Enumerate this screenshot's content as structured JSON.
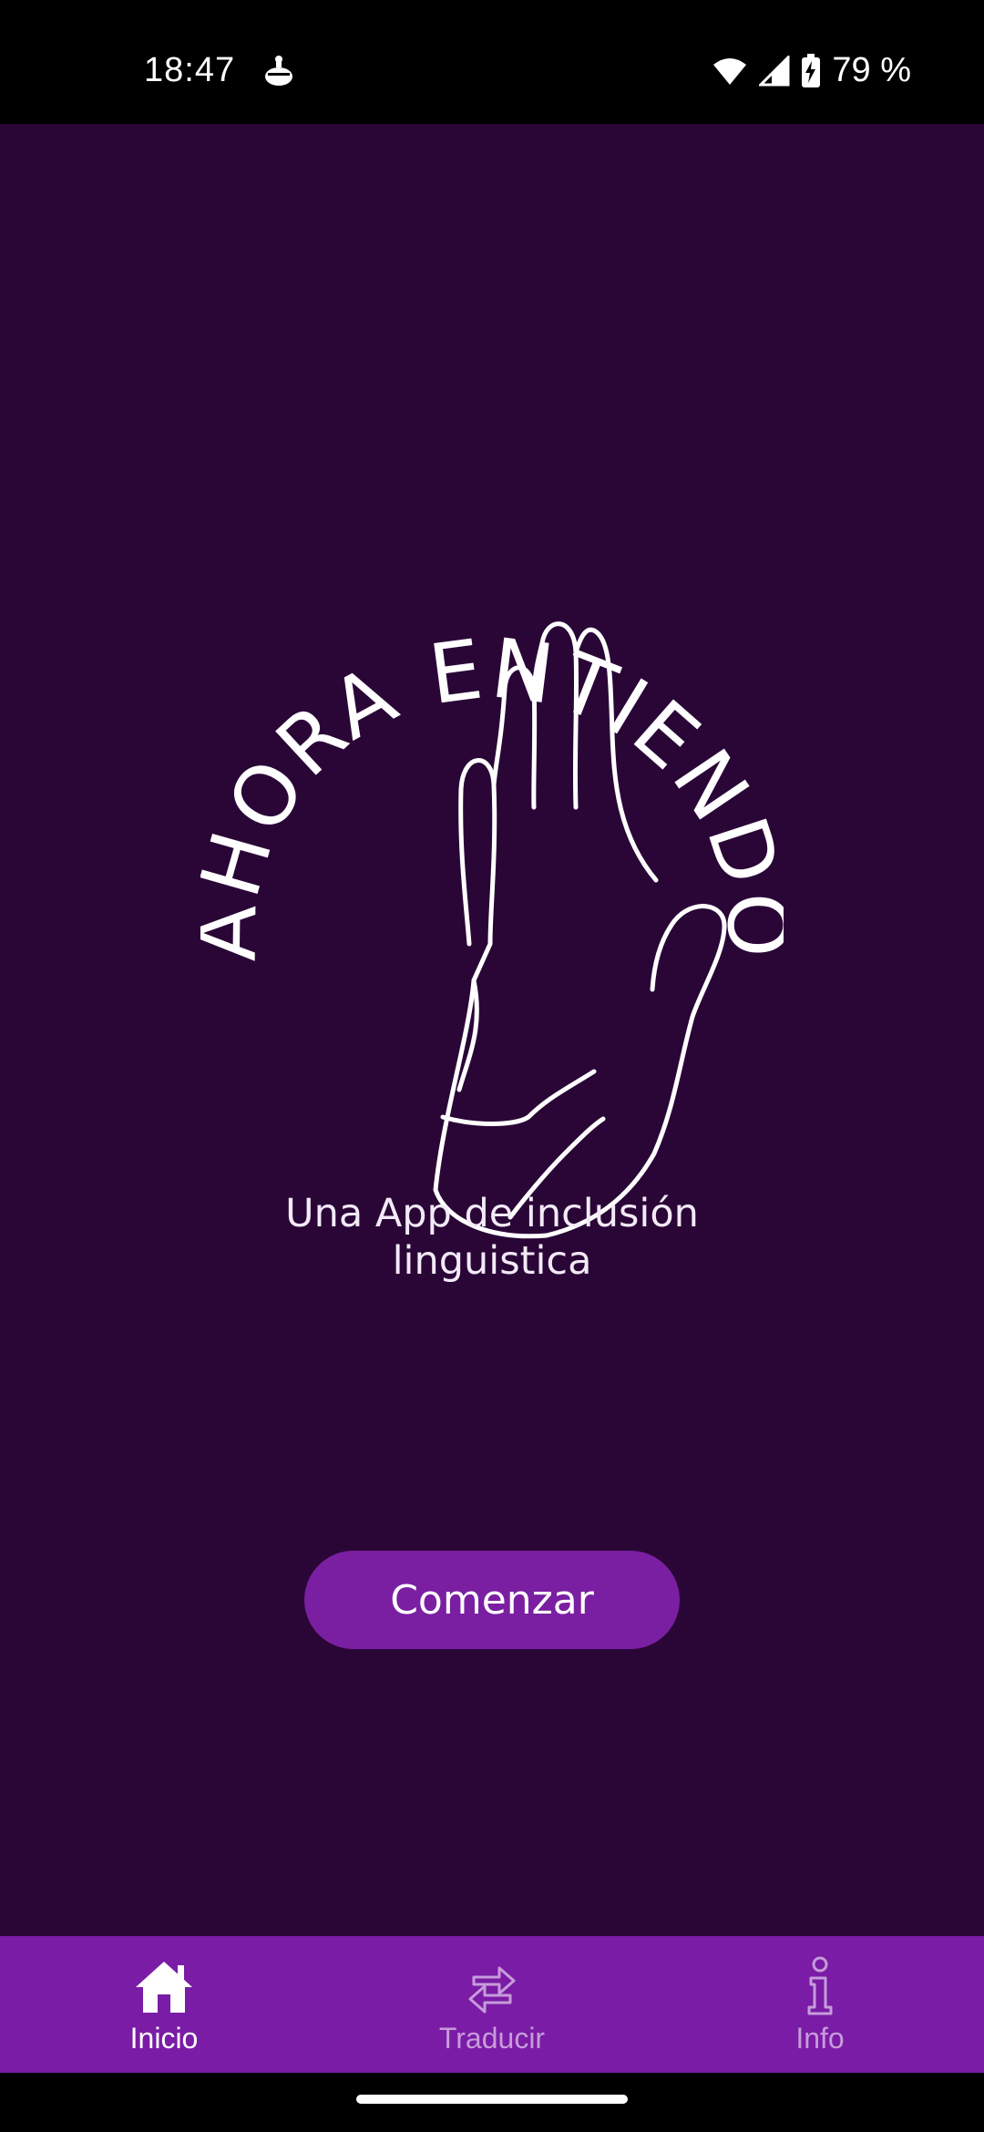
{
  "status_bar": {
    "time": "18:47",
    "battery": "79 %",
    "icons": [
      "notification-icon",
      "wifi-icon",
      "signal-icon",
      "battery-charging-icon"
    ]
  },
  "logo": {
    "title": "AHORA ENTIENDO",
    "icon": "raised-hand-icon"
  },
  "tagline": {
    "line1": "Una App de inclusión",
    "line2": "linguistica"
  },
  "actions": {
    "start_label": "Comenzar"
  },
  "bottom_nav": {
    "items": [
      {
        "label": "Inicio",
        "icon": "home-icon",
        "active": true
      },
      {
        "label": "Traducir",
        "icon": "swap-arrows-icon",
        "active": false
      },
      {
        "label": "Info",
        "icon": "info-icon",
        "active": false
      }
    ]
  },
  "colors": {
    "background": "#2A0637",
    "accent": "#7A1FA2",
    "nav_background": "#7A1CA5",
    "text": "#FFFFFF",
    "inactive": "#C79BDB"
  }
}
